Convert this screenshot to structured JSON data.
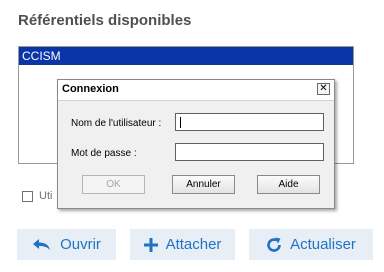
{
  "section": {
    "title": "Référentiels disponibles"
  },
  "repo_list": {
    "items": [
      {
        "label": "CCISM",
        "selected": true
      }
    ]
  },
  "checkbox": {
    "label_visible": "Uti",
    "checked": false
  },
  "dialog": {
    "title": "Connexion",
    "close_glyph": "✕",
    "username_label": "Nom de l'utilisateur :",
    "username_value": "",
    "password_label": "Mot de passe :",
    "password_value": "",
    "buttons": {
      "ok": "OK",
      "cancel": "Annuler",
      "help": "Aide"
    }
  },
  "actions": {
    "open": {
      "label": "Ouvrir",
      "icon": "undo-arrow-icon"
    },
    "attach": {
      "label": "Attacher",
      "icon": "plus-icon"
    },
    "refresh": {
      "label": "Actualiser",
      "icon": "refresh-icon"
    }
  },
  "colors": {
    "selection": "#0a35a6",
    "action_text": "#1f73c4",
    "action_bg": "#e8eef5"
  }
}
